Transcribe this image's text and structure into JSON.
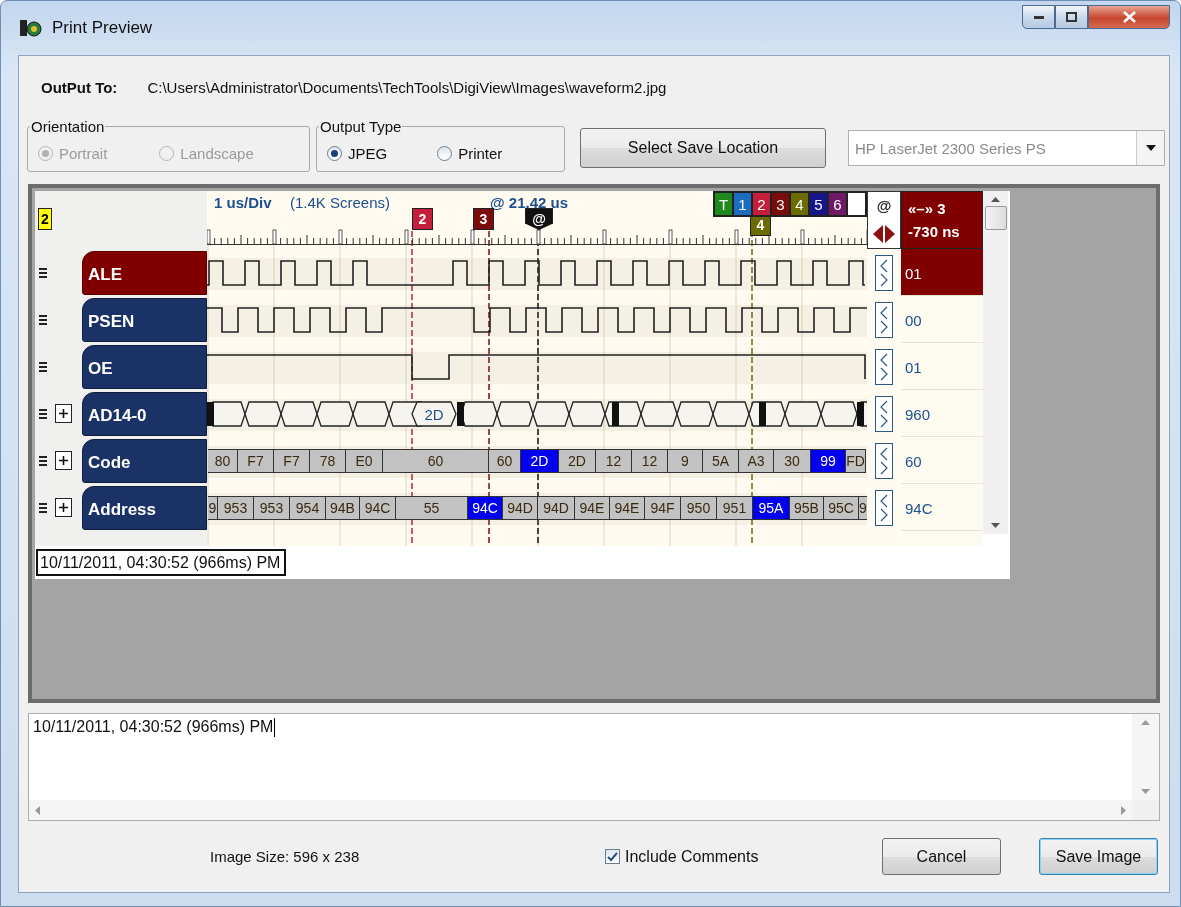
{
  "window": {
    "title": "Print Preview"
  },
  "output_to": {
    "label": "OutPut To:",
    "path": "C:\\Users\\Administrator\\Documents\\TechTools\\DigiView\\Images\\waveform2.jpg"
  },
  "orientation": {
    "title": "Orientation",
    "disabled": true,
    "options": [
      {
        "label": "Portrait",
        "selected": true
      },
      {
        "label": "Landscape",
        "selected": false
      }
    ]
  },
  "output_type": {
    "title": "Output Type",
    "disabled": false,
    "options": [
      {
        "label": "JPEG",
        "selected": true
      },
      {
        "label": "Printer",
        "selected": false
      }
    ]
  },
  "select_location_button": {
    "label": "Select Save Location"
  },
  "printer": {
    "value": "HP LaserJet 2300 Series PS",
    "disabled": true
  },
  "waveform": {
    "zoom_badge": "2",
    "scale": "1 us/Div",
    "screens": "(1.4K Screens)",
    "position": "@ 21.42 us",
    "marker_buttons": [
      {
        "label": "T",
        "color": "#1e8a1e"
      },
      {
        "label": "1",
        "color": "#1c6cc0"
      },
      {
        "label": "2",
        "color": "#c41e3a"
      },
      {
        "label": "3",
        "color": "#7b0c0c"
      },
      {
        "label": "4",
        "color": "#6b6b00"
      },
      {
        "label": "5",
        "color": "#16168a"
      },
      {
        "label": "6",
        "color": "#6e1a66"
      },
      {
        "color": "#ffffff"
      }
    ],
    "cursors": [
      {
        "label": "2",
        "color": "#c41e3a"
      },
      {
        "label": "3",
        "color": "#7b0c0c"
      },
      {
        "label": "@",
        "color": "#111111"
      },
      {
        "label": "4",
        "color": "#6b6b00"
      }
    ],
    "at_column": "@",
    "delta": {
      "label": "«–» 3",
      "value": "-730 ns"
    },
    "signals": [
      {
        "name": "ALE",
        "kind": "bit",
        "selected": true,
        "expandable": false,
        "value": "01"
      },
      {
        "name": "PSEN",
        "kind": "bit",
        "selected": false,
        "expandable": false,
        "value": "00"
      },
      {
        "name": "OE",
        "kind": "bit",
        "selected": false,
        "expandable": false,
        "value": "01"
      },
      {
        "name": "AD14-0",
        "kind": "eyes",
        "selected": false,
        "expandable": true,
        "value": "960",
        "segments": [
          {
            "text": "2D",
            "highlighted": false
          }
        ]
      },
      {
        "name": "Code",
        "kind": "bus",
        "selected": false,
        "expandable": true,
        "value": "60",
        "segments": [
          {
            "text": "80",
            "highlighted": false
          },
          {
            "text": "F7",
            "highlighted": false
          },
          {
            "text": "F7",
            "highlighted": false
          },
          {
            "text": "78",
            "highlighted": false
          },
          {
            "text": "E0",
            "highlighted": false
          },
          {
            "text": "60",
            "highlighted": false
          },
          {
            "text": "60",
            "highlighted": false
          },
          {
            "text": "2D",
            "highlighted": true
          },
          {
            "text": "2D",
            "highlighted": false
          },
          {
            "text": "12",
            "highlighted": false
          },
          {
            "text": "12",
            "highlighted": false
          },
          {
            "text": "9",
            "highlighted": false
          },
          {
            "text": "5A",
            "highlighted": false
          },
          {
            "text": "A3",
            "highlighted": false
          },
          {
            "text": "30",
            "highlighted": false
          },
          {
            "text": "99",
            "highlighted": true
          },
          {
            "text": "FD",
            "highlighted": false
          }
        ]
      },
      {
        "name": "Address",
        "kind": "bus",
        "selected": false,
        "expandable": true,
        "value": "94C",
        "segments": [
          {
            "text": "9",
            "highlighted": false
          },
          {
            "text": "953",
            "highlighted": false
          },
          {
            "text": "953",
            "highlighted": false
          },
          {
            "text": "954",
            "highlighted": false
          },
          {
            "text": "94B",
            "highlighted": false
          },
          {
            "text": "94C",
            "highlighted": false
          },
          {
            "text": "55",
            "highlighted": false
          },
          {
            "text": "94C",
            "highlighted": true
          },
          {
            "text": "94D",
            "highlighted": false
          },
          {
            "text": "94D",
            "highlighted": false
          },
          {
            "text": "94E",
            "highlighted": false
          },
          {
            "text": "94E",
            "highlighted": false
          },
          {
            "text": "94F",
            "highlighted": false
          },
          {
            "text": "950",
            "highlighted": false
          },
          {
            "text": "951",
            "highlighted": false
          },
          {
            "text": "95A",
            "highlighted": true
          },
          {
            "text": "95B",
            "highlighted": false
          },
          {
            "text": "95C",
            "highlighted": false
          },
          {
            "text": "9",
            "highlighted": false
          }
        ]
      }
    ],
    "timestamp": "10/11/2011, 04:30:52 (966ms) PM"
  },
  "comments": {
    "text": "10/11/2011, 04:30:52 (966ms) PM"
  },
  "image_size": "Image Size: 596 x 238",
  "include_comments": {
    "label": "Include Comments",
    "checked": true
  },
  "buttons": [
    {
      "label": "Cancel",
      "default": false
    },
    {
      "label": "Save Image",
      "default": true
    }
  ]
}
